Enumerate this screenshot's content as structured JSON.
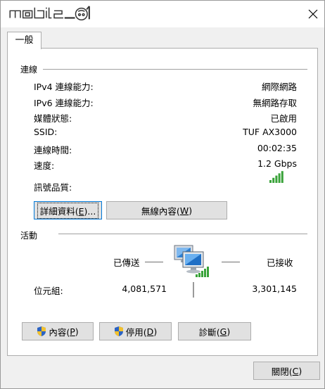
{
  "titlebar": {
    "logo_text": "mobile01"
  },
  "tabs": [
    {
      "label": "一般"
    }
  ],
  "connection": {
    "title": "連線",
    "rows": [
      {
        "label": "IPv4 連線能力:",
        "value": "網際網路"
      },
      {
        "label": "IPv6 連線能力:",
        "value": "無網路存取"
      },
      {
        "label": "媒體狀態:",
        "value": "已啟用"
      },
      {
        "label": "SSID:",
        "value": "TUF AX3000"
      },
      {
        "label": "連線時間:",
        "value": "00:02:35"
      },
      {
        "label": "速度:",
        "value": "1.2 Gbps"
      }
    ],
    "signal_label": "訊號品質:",
    "signal_bars": 5,
    "signal_color": "#3aa33a"
  },
  "buttons": {
    "details": {
      "text": "詳細資料(",
      "key": "E",
      "suffix": ")..."
    },
    "wireless": {
      "text": "無線內容(",
      "key": "W",
      "suffix": ")"
    },
    "properties": {
      "text": "內容(",
      "key": "P",
      "suffix": ")"
    },
    "disable": {
      "text": "停用(",
      "key": "D",
      "suffix": ")"
    },
    "diagnose": {
      "text": "診斷(",
      "key": "G",
      "suffix": ")"
    },
    "close": {
      "text": "關閉(",
      "key": "C",
      "suffix": ")"
    }
  },
  "activity": {
    "title": "活動",
    "sent_label": "已傳送",
    "received_label": "已接收",
    "bytes_label": "位元組:",
    "bytes_sent": "4,081,571",
    "bytes_received": "3,301,145"
  }
}
